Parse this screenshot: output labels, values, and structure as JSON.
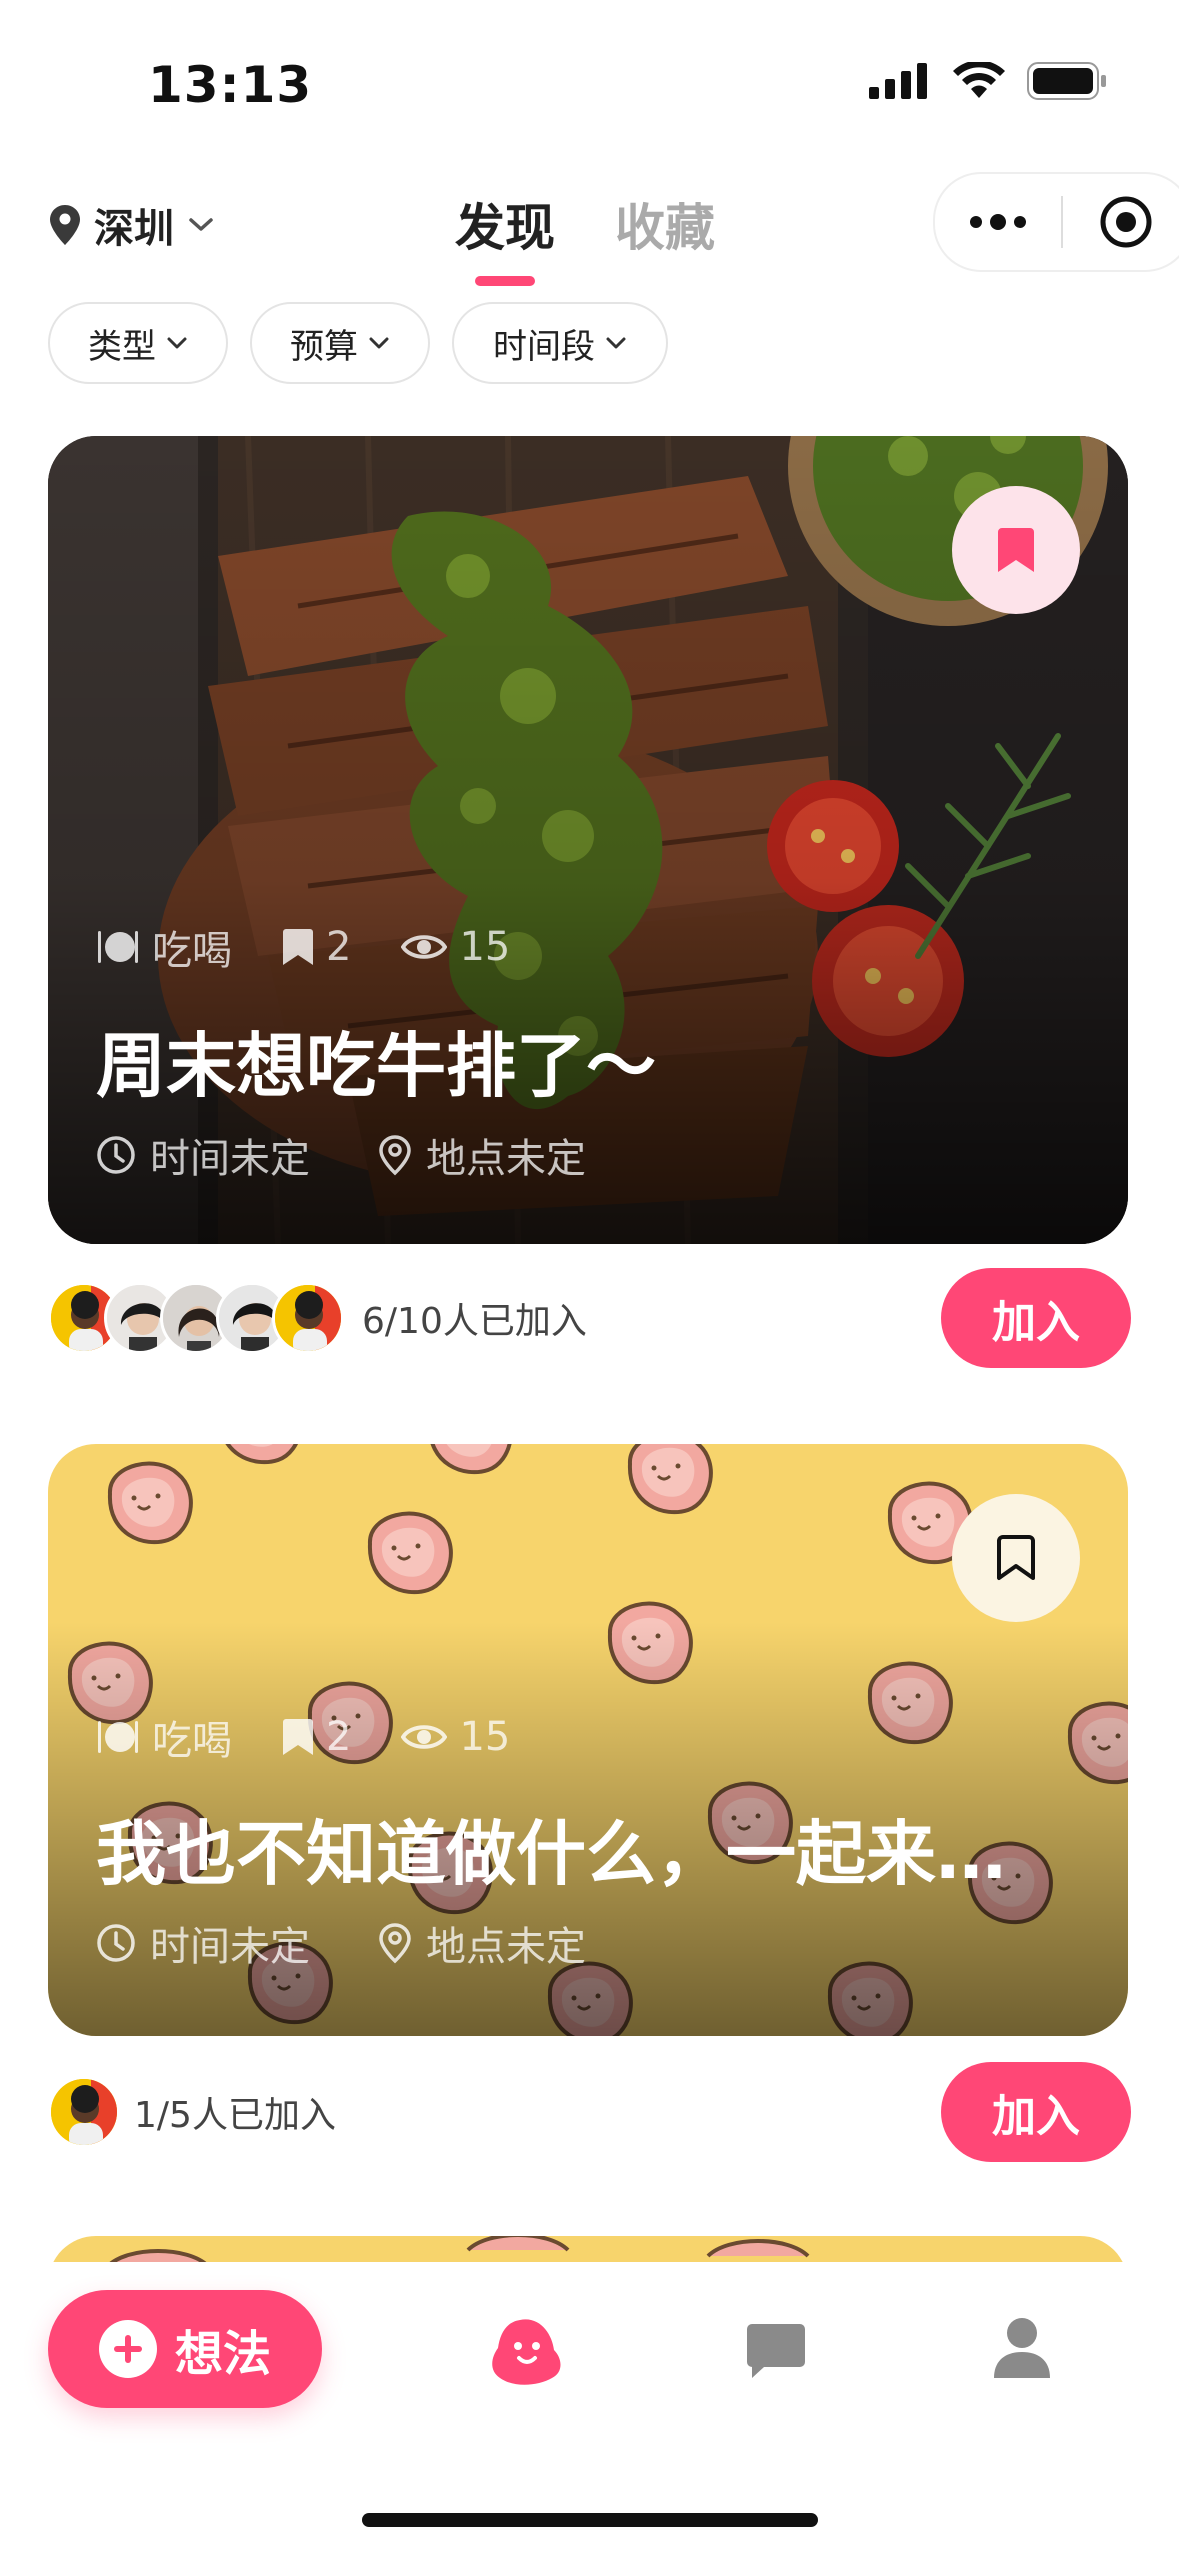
{
  "status_bar": {
    "time": "13:13"
  },
  "header": {
    "city": "深圳",
    "tabs": [
      {
        "label": "发现",
        "active": true
      },
      {
        "label": "收藏",
        "active": false
      }
    ]
  },
  "filters": [
    {
      "label": "类型"
    },
    {
      "label": "预算"
    },
    {
      "label": "时间段"
    }
  ],
  "cards": [
    {
      "category": "吃喝",
      "bookmarks": "2",
      "views": "15",
      "title": "周末想吃牛排了～",
      "time": "时间未定",
      "place": "地点未定",
      "bookmarked": true,
      "joined_text": "6/10人已加入",
      "join_label": "加入"
    },
    {
      "category": "吃喝",
      "bookmarks": "2",
      "views": "15",
      "title": "我也不知道做什么，一起来…",
      "time": "时间未定",
      "place": "地点未定",
      "bookmarked": false,
      "joined_text": "1/5人已加入",
      "join_label": "加入"
    }
  ],
  "bottom_nav": {
    "fab_label": "想法",
    "items": [
      {
        "icon": "blob-mascot-icon",
        "active": true
      },
      {
        "icon": "chat-bubble-icon",
        "active": false
      },
      {
        "icon": "profile-icon",
        "active": false
      }
    ]
  },
  "colors": {
    "accent": "#ff4776",
    "text": "#222222",
    "muted": "#aaaaaa"
  }
}
